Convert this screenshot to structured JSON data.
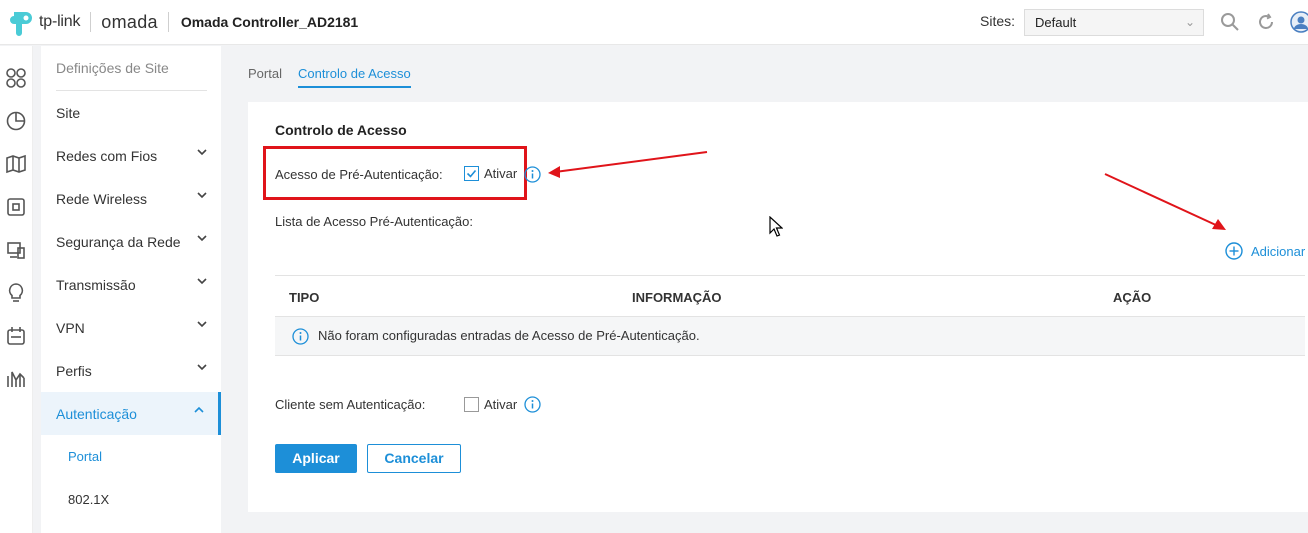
{
  "header": {
    "tp_brand": "tp-link",
    "omada_brand": "omada",
    "controller_title": "Omada Controller_AD2181",
    "sites_label": "Sites:",
    "sites_value": "Default"
  },
  "rail_icons": [
    "dashboard-icon",
    "statistics-icon",
    "map-icon",
    "devices-icon",
    "clients-icon",
    "insights-icon",
    "logs-icon",
    "reports-icon"
  ],
  "sidebar": {
    "header": "Definições de Site",
    "items": [
      {
        "label": "Site"
      },
      {
        "label": "Redes com Fios"
      },
      {
        "label": "Rede Wireless"
      },
      {
        "label": "Segurança da Rede"
      },
      {
        "label": "Transmissão"
      },
      {
        "label": "VPN"
      },
      {
        "label": "Perfis"
      },
      {
        "label": "Autenticação"
      }
    ],
    "subitems": [
      {
        "label": "Portal"
      },
      {
        "label": "802.1X"
      }
    ]
  },
  "tabs": [
    {
      "label": "Portal"
    },
    {
      "label": "Controlo de Acesso"
    }
  ],
  "main": {
    "section_title": "Controlo de Acesso",
    "pre_auth_label": "Acesso de Pré-Autenticação:",
    "pre_auth_checkbox_label": "Ativar",
    "pre_auth_checked": true,
    "pre_auth_list_label": "Lista de Acesso Pré-Autenticação:",
    "add_label": "Adicionar",
    "table": {
      "columns": [
        "TIPO",
        "INFORMAÇÃO",
        "AÇÃO"
      ],
      "empty_message": "Não foram configuradas entradas de Acesso de Pré-Autenticação."
    },
    "no_auth_label": "Cliente sem Autenticação:",
    "no_auth_checkbox_label": "Ativar",
    "no_auth_checked": false,
    "apply_label": "Aplicar",
    "cancel_label": "Cancelar"
  },
  "colors": {
    "accent": "#1d8fd8",
    "annotation": "#e0141a",
    "omada_teal": "#20b1b5"
  }
}
